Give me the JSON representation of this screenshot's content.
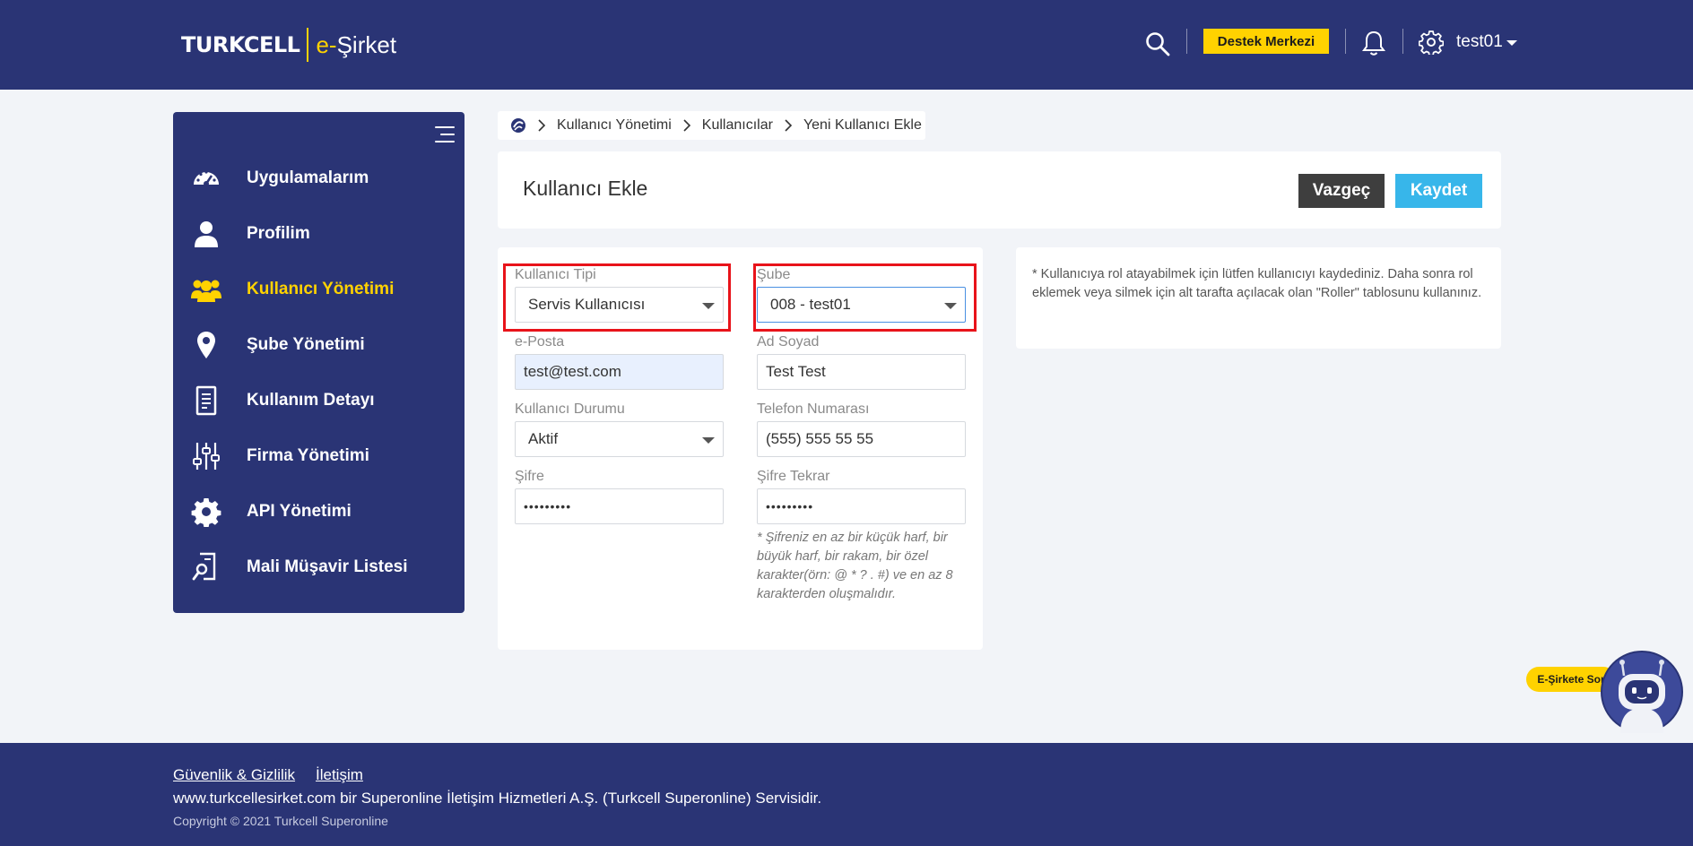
{
  "header": {
    "brand": "TURKCELL",
    "product_prefix": "e-",
    "product_name": "Şirket",
    "support_label": "Destek Merkezi",
    "username": "test01"
  },
  "sidebar": {
    "items": [
      {
        "label": "Uygulamalarım",
        "icon": "dashboard-icon",
        "active": false
      },
      {
        "label": "Profilim",
        "icon": "user-icon",
        "active": false
      },
      {
        "label": "Kullanıcı Yönetimi",
        "icon": "users-icon",
        "active": true
      },
      {
        "label": "Şube Yönetimi",
        "icon": "map-pin-icon",
        "active": false
      },
      {
        "label": "Kullanım Detayı",
        "icon": "document-icon",
        "active": false
      },
      {
        "label": "Firma Yönetimi",
        "icon": "sliders-icon",
        "active": false
      },
      {
        "label": "API Yönetimi",
        "icon": "gear-icon",
        "active": false
      },
      {
        "label": "Mali Müşavir Listesi",
        "icon": "document-search-icon",
        "active": false
      }
    ]
  },
  "breadcrumb": [
    "Kullanıcı Yönetimi",
    "Kullanıcılar",
    "Yeni Kullanıcı Ekle"
  ],
  "page": {
    "title": "Kullanıcı Ekle",
    "cancel_label": "Vazgeç",
    "save_label": "Kaydet"
  },
  "form": {
    "user_type": {
      "label": "Kullanıcı Tipi",
      "value": "Servis Kullanıcısı"
    },
    "branch": {
      "label": "Şube",
      "value": "008 - test01"
    },
    "email": {
      "label": "e-Posta",
      "value": "test@test.com"
    },
    "full_name": {
      "label": "Ad Soyad",
      "value": "Test Test"
    },
    "status": {
      "label": "Kullanıcı Durumu",
      "value": "Aktif"
    },
    "phone": {
      "label": "Telefon Numarası",
      "value": "(555) 555 55 55"
    },
    "password": {
      "label": "Şifre",
      "value": "•••••••••"
    },
    "password_repeat": {
      "label": "Şifre Tekrar",
      "value": "•••••••••"
    },
    "password_hint": "* Şifreniz en az bir küçük harf, bir büyük harf, bir rakam, bir özel karakter(örn: @ * ? . #) ve en az 8 karakterden oluşmalıdır."
  },
  "info": {
    "text": "* Kullanıcıya rol atayabilmek için lütfen kullanıcıyı kaydediniz. Daha sonra rol eklemek veya silmek için alt tarafta açılacak olan \"Roller\" tablosunu kullanınız."
  },
  "chatbot": {
    "label": "E-Şirkete Sor"
  },
  "footer": {
    "links": [
      "Güvenlik & Gizlilik",
      "İletişim"
    ],
    "text": "www.turkcellesirket.com bir Superonline İletişim Hizmetleri A.Ş. (Turkcell Superonline) Servisidir.",
    "copyright": "Copyright © 2021 Turkcell Superonline"
  },
  "colors": {
    "navy": "#2a3475",
    "yellow": "#ffd200",
    "save_blue": "#37b6ea",
    "cancel_dark": "#3e3e3e",
    "highlight_red": "#e8131a"
  }
}
